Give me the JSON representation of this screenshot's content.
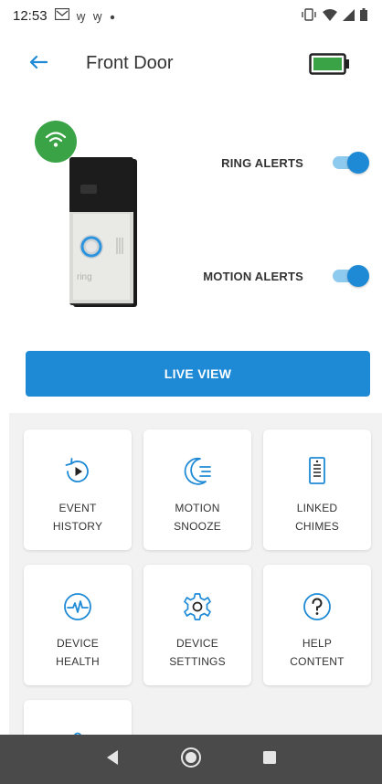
{
  "status_bar": {
    "time": "12:53",
    "left_icons": [
      "mail-icon",
      "sign-icon",
      "sign-icon",
      "dot-icon"
    ],
    "right_icons": [
      "vibrate-icon",
      "wifi-icon",
      "signal-icon",
      "battery-icon"
    ],
    "notif_1": "ꝡ",
    "notif_2": "ꝡ"
  },
  "header": {
    "title": "Front Door",
    "back_icon": "arrow-left-icon",
    "battery_icon": "battery-full-icon",
    "battery_color": "#3aa345"
  },
  "device": {
    "wifi_icon": "wifi-icon",
    "brand_text": "ring",
    "toggles": [
      {
        "label": "RING ALERTS",
        "on": true
      },
      {
        "label": "MOTION ALERTS",
        "on": true
      }
    ]
  },
  "live_view": {
    "label": "LIVE VIEW",
    "color": "#1e8ad6"
  },
  "tiles": [
    {
      "label": "EVENT\nHISTORY",
      "icon": "history-play-icon"
    },
    {
      "label": "MOTION\nSNOOZE",
      "icon": "moon-snooze-icon"
    },
    {
      "label": "LINKED\nCHIMES",
      "icon": "chime-icon"
    },
    {
      "label": "DEVICE\nHEALTH",
      "icon": "heartbeat-icon"
    },
    {
      "label": "DEVICE\nSETTINGS",
      "icon": "gear-icon"
    },
    {
      "label": "HELP\nCONTENT",
      "icon": "question-icon"
    },
    {
      "label": "",
      "icon": "shared-users-icon"
    }
  ],
  "nav": {
    "back": "nav-back-icon",
    "home": "nav-home-icon",
    "recents": "nav-recents-icon"
  },
  "colors": {
    "accent": "#1e8ad6",
    "green": "#3aa345"
  }
}
